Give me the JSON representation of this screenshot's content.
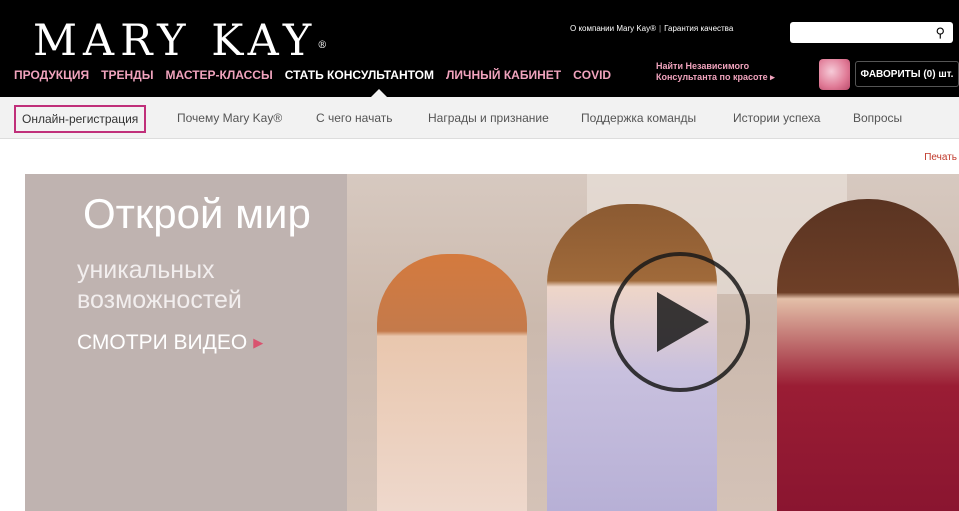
{
  "brand": {
    "logo_text": "MARY KAY",
    "logo_mark": "®"
  },
  "top_links": {
    "about": "О компании Mary Kay®",
    "separator": "|",
    "quality": "Гарантия качества"
  },
  "search": {
    "placeholder": "",
    "icon": "search-icon"
  },
  "main_nav": {
    "items": [
      {
        "label": "ПРОДУКЦИЯ"
      },
      {
        "label": "ТРЕНДЫ"
      },
      {
        "label": "МАСТЕР-КЛАССЫ"
      },
      {
        "label": "СТАТЬ КОНСУЛЬТАНТОМ",
        "active": true
      },
      {
        "label": "ЛИЧНЫЙ КАБИНЕТ"
      },
      {
        "label": "COVID"
      }
    ]
  },
  "finder": {
    "line1": "Найти Независимого",
    "line2": "Консультанта по красоте ▸"
  },
  "favorites": {
    "label": "ФАВОРИТЫ (0) шт."
  },
  "sub_nav": {
    "items": [
      {
        "label": "Онлайн-регистрация",
        "highlighted": true
      },
      {
        "label": "Почему Mary Kay®"
      },
      {
        "label": "С чего начать"
      },
      {
        "label": "Награды и признание"
      },
      {
        "label": "Поддержка команды"
      },
      {
        "label": "Истории успеха"
      },
      {
        "label": "Вопросы"
      }
    ]
  },
  "print": {
    "label": "Печать"
  },
  "hero": {
    "title": "Открой мир",
    "subtitle_line1": "уникальных",
    "subtitle_line2": "возможностей",
    "cta": "СМОТРИ ВИДЕО",
    "cta_arrow": "▶"
  },
  "colors": {
    "accent_pink": "#f0a3bd",
    "highlight_border": "#c02f7a",
    "print_red": "#c0392b"
  }
}
